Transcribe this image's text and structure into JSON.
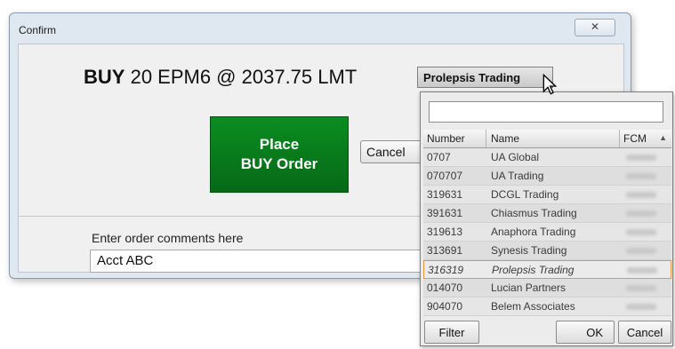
{
  "window": {
    "title": "Confirm",
    "close_icon": "close-icon"
  },
  "order": {
    "side": "BUY",
    "details": "20 EPM6 @ 2037.75 LMT",
    "place_button": "Place\nBUY Order",
    "cancel_button": "Cancel",
    "place_color": "#0b8d21"
  },
  "account_select": {
    "selected": "Prolepsis Trading"
  },
  "comments": {
    "label": "Enter order comments here",
    "value": "Acct ABC"
  },
  "picker": {
    "search_value": "",
    "columns": [
      "Number",
      "Name",
      "FCM"
    ],
    "rows": [
      {
        "number": "0707",
        "name": "UA Global"
      },
      {
        "number": "070707",
        "name": "UA Trading"
      },
      {
        "number": "319631",
        "name": "DCGL Trading"
      },
      {
        "number": "391631",
        "name": "Chiasmus Trading"
      },
      {
        "number": "319613",
        "name": "Anaphora Trading"
      },
      {
        "number": "313691",
        "name": "Synesis Trading"
      },
      {
        "number": "316319",
        "name": "Prolepsis Trading"
      },
      {
        "number": "014070",
        "name": "Lucian Partners"
      },
      {
        "number": "904070",
        "name": "Belem Associates"
      }
    ],
    "selected_number": "316319",
    "selection_color": "#e8973f",
    "filter_button": "Filter",
    "ok_button": "OK",
    "cancel_button": "Cancel"
  }
}
